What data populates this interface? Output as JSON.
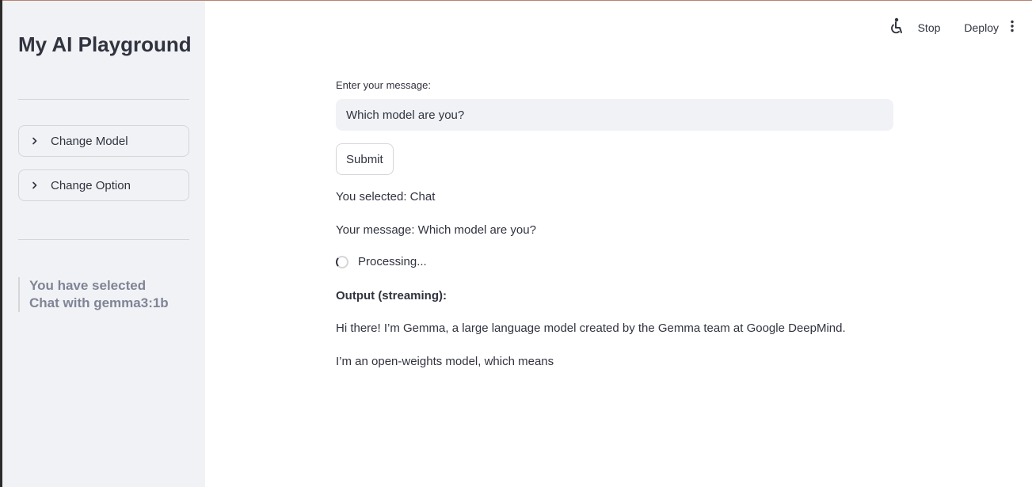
{
  "sidebar": {
    "title": "My AI Playground",
    "expanders": [
      {
        "label": "Change Model"
      },
      {
        "label": "Change Option"
      }
    ],
    "selection_info": "You have selected Chat with gemma3:1b"
  },
  "toolbar": {
    "stop_label": "Stop",
    "deploy_label": "Deploy"
  },
  "main": {
    "input_label": "Enter your message:",
    "input_value": "Which model are you?",
    "submit_label": "Submit",
    "selected_text": "You selected: Chat",
    "message_text": "Your message: Which model are you?",
    "status_text": "Processing...",
    "output_heading": "Output (streaming):",
    "output_paragraphs": [
      "Hi there! I’m Gemma, a large language model created by the Gemma team at Google DeepMind.",
      "I’m an open-weights model, which means"
    ]
  },
  "icons": {
    "accessibility": "accessibility-icon",
    "menu": "more-vertical-icon",
    "chevron": "chevron-right-icon"
  }
}
